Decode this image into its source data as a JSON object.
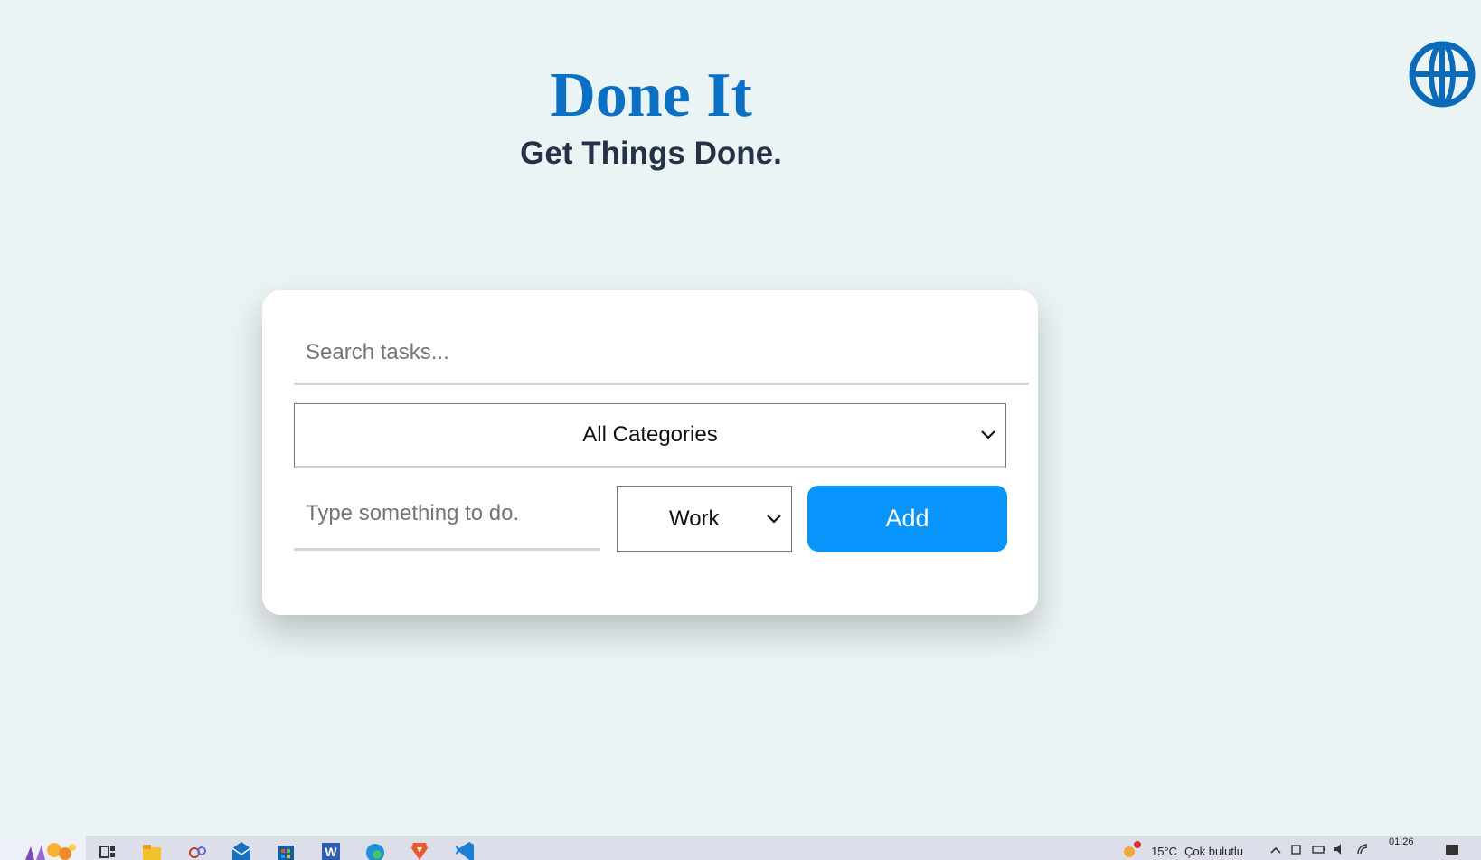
{
  "app": {
    "title": "Done It",
    "subtitle": "Get Things Done."
  },
  "colors": {
    "background": "#ebf4f4",
    "title": "#0b70c3",
    "subtitle": "#263047",
    "accent_button": "#0794fb",
    "card": "#ffffff"
  },
  "language_button": {
    "icon": "globe-icon"
  },
  "search": {
    "placeholder": "Search tasks...",
    "value": ""
  },
  "category_filter": {
    "selected": "All Categories",
    "icon": "chevron-down-icon"
  },
  "new_task": {
    "placeholder": "Type something to do.",
    "value": "",
    "category_selected": "Work",
    "add_label": "Add"
  },
  "taskbar": {
    "apps": [
      "start-icon",
      "widgets-icon",
      "file-explorer-icon",
      "snipping-tool-icon",
      "mail-icon",
      "store-icon",
      "word-icon",
      "edge-icon",
      "brave-icon",
      "vscode-icon"
    ],
    "weather_temp": "15°C",
    "weather_desc": "Çok bulutlu",
    "clock_time": "01:26"
  }
}
